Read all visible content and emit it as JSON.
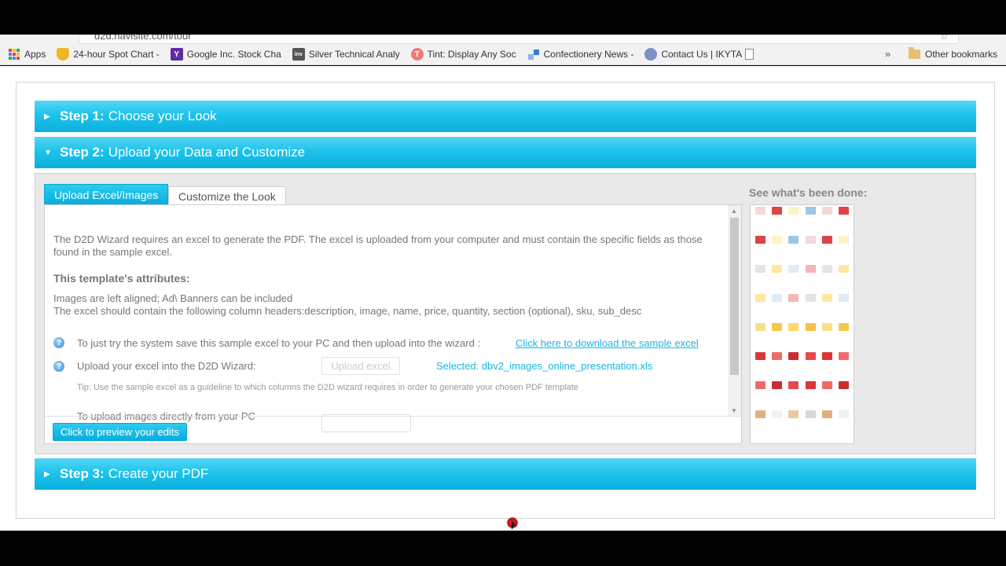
{
  "browser": {
    "url": "d2d.navisite.com/tour",
    "bookmarks": [
      {
        "label": "Apps",
        "icon": "apps-grid-icon"
      },
      {
        "label": "24-hour Spot Chart -",
        "icon": "gold-shield-icon",
        "color": "#e9b824"
      },
      {
        "label": "Google Inc. Stock Cha",
        "icon": "yahoo-icon",
        "color": "#5f2ca0",
        "glyph": "Y"
      },
      {
        "label": "Silver Technical Analy",
        "icon": "inv-icon",
        "color": "#555555",
        "glyph": "inv"
      },
      {
        "label": "Tint: Display Any Soc",
        "icon": "tint-icon",
        "color": "#f07a7a",
        "glyph": "T"
      },
      {
        "label": "Confectionery News -",
        "icon": "confectionery-icon",
        "color": "#3a7bd5"
      },
      {
        "label": "Contact Us | IKYTA",
        "icon": "ikyta-icon",
        "color": "#7c90c7"
      }
    ],
    "more_label": "»",
    "other_bookmarks": "Other bookmarks"
  },
  "wizard": {
    "step1": {
      "num": "Step 1:",
      "title": "Choose your Look",
      "arrow": "▶"
    },
    "step2": {
      "num": "Step 2:",
      "title": "Upload your Data and Customize",
      "arrow": "▼"
    },
    "step3": {
      "num": "Step 3:",
      "title": "Create your PDF",
      "arrow": "▶"
    },
    "tabs": {
      "upload": "Upload Excel/Images",
      "customize": "Customize the Look"
    },
    "content": {
      "intro": "The D2D Wizard requires an excel to generate the PDF. The excel is uploaded from your computer and must contain the specific fields as those found in the sample excel.",
      "attributes_heading": "This template's attributes:",
      "attr_line1": "Images are left aligned; Ad\\ Banners can be included",
      "attr_line2": "The excel should contain the following column headers:description, image, name, price, quantity, section (optional), sku, sub_desc",
      "try_text": "To just try the system save this sample excel to your PC and then upload into the wizard :",
      "download_link": "Click here to download the sample excel",
      "upload_label": "Upload your excel into the D2D Wizard:",
      "upload_button": "Upload excel",
      "selected": "Selected: dbv2_images_online_presentation.xls",
      "tip": "Tip: Use the sample excel as a guideline to which columns the D2D wizard requires in order to generate your chosen PDF template",
      "images_label": "To upload images directly from your PC"
    },
    "preview_button": "Click to preview your edits",
    "see_done": "See what's been done:"
  },
  "colors": {
    "accent": "#1ec3ec",
    "link": "#19b6e4"
  }
}
